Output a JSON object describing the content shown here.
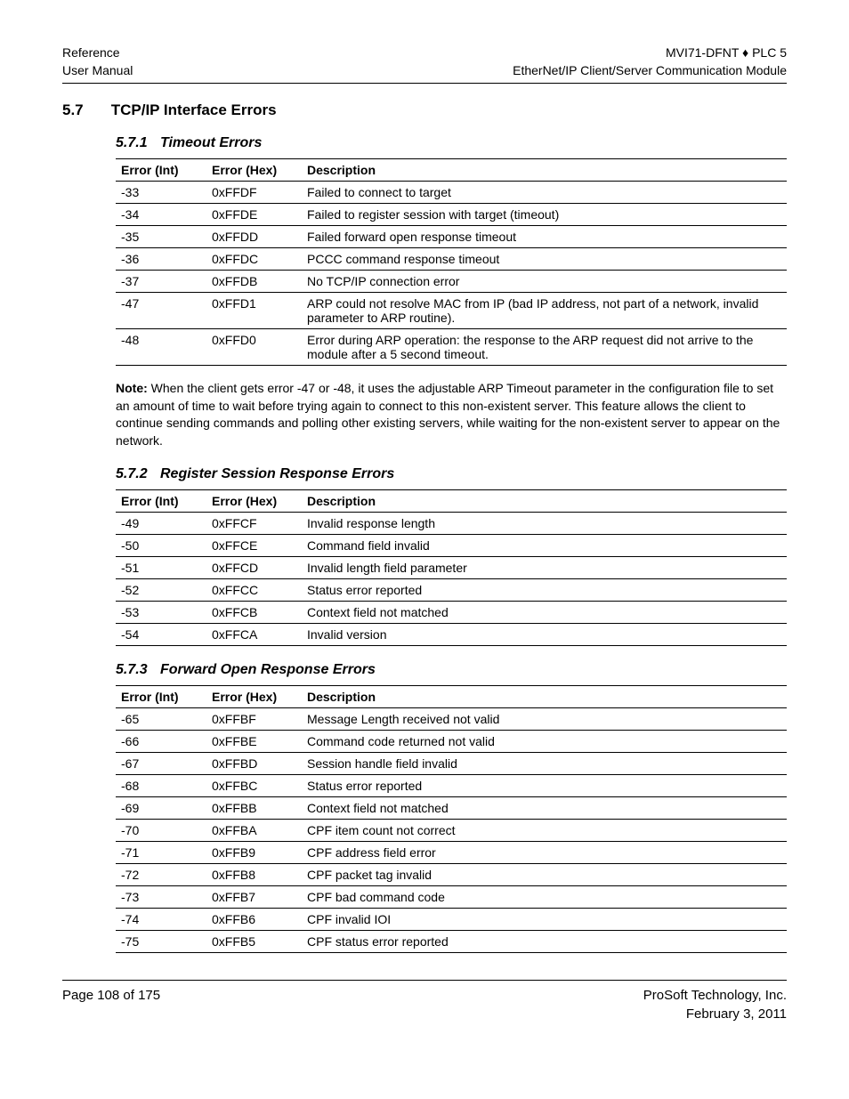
{
  "header": {
    "left_line1": "Reference",
    "left_line2": "User Manual",
    "right_line1": "MVI71-DFNT ♦ PLC 5",
    "right_line2": "EtherNet/IP Client/Server Communication Module"
  },
  "section": {
    "number": "5.7",
    "title": "TCP/IP Interface Errors"
  },
  "tables": [
    {
      "sub_number": "5.7.1",
      "sub_title": "Timeout Errors",
      "headers": {
        "c1": "Error (Int)",
        "c2": "Error (Hex)",
        "c3": "Description"
      },
      "rows": [
        {
          "int": "-33",
          "hex": "0xFFDF",
          "desc": "Failed to connect to target"
        },
        {
          "int": "-34",
          "hex": "0xFFDE",
          "desc": "Failed to register session with target (timeout)"
        },
        {
          "int": "-35",
          "hex": "0xFFDD",
          "desc": "Failed forward open response timeout"
        },
        {
          "int": "-36",
          "hex": "0xFFDC",
          "desc": "PCCC command response timeout"
        },
        {
          "int": "-37",
          "hex": "0xFFDB",
          "desc": "No TCP/IP connection error"
        },
        {
          "int": "-47",
          "hex": "0xFFD1",
          "desc": "ARP could not resolve MAC from IP (bad IP address, not part of a network, invalid parameter to ARP routine)."
        },
        {
          "int": "-48",
          "hex": "0xFFD0",
          "desc": "Error during ARP operation: the response to the ARP request did not arrive to the module after a 5 second timeout."
        }
      ]
    },
    {
      "sub_number": "5.7.2",
      "sub_title": "Register Session Response Errors",
      "headers": {
        "c1": "Error (Int)",
        "c2": "Error (Hex)",
        "c3": "Description"
      },
      "rows": [
        {
          "int": "-49",
          "hex": "0xFFCF",
          "desc": "Invalid response length"
        },
        {
          "int": "-50",
          "hex": "0xFFCE",
          "desc": "Command field invalid"
        },
        {
          "int": "-51",
          "hex": "0xFFCD",
          "desc": "Invalid length field parameter"
        },
        {
          "int": "-52",
          "hex": "0xFFCC",
          "desc": "Status error reported"
        },
        {
          "int": "-53",
          "hex": "0xFFCB",
          "desc": "Context field not matched"
        },
        {
          "int": "-54",
          "hex": "0xFFCA",
          "desc": "Invalid version"
        }
      ]
    },
    {
      "sub_number": "5.7.3",
      "sub_title": "Forward Open Response Errors",
      "headers": {
        "c1": "Error (Int)",
        "c2": "Error (Hex)",
        "c3": "Description"
      },
      "rows": [
        {
          "int": "-65",
          "hex": "0xFFBF",
          "desc": "Message Length received not valid"
        },
        {
          "int": "-66",
          "hex": "0xFFBE",
          "desc": "Command code returned not valid"
        },
        {
          "int": "-67",
          "hex": "0xFFBD",
          "desc": "Session handle field invalid"
        },
        {
          "int": "-68",
          "hex": "0xFFBC",
          "desc": "Status error reported"
        },
        {
          "int": "-69",
          "hex": "0xFFBB",
          "desc": "Context field not matched"
        },
        {
          "int": "-70",
          "hex": "0xFFBA",
          "desc": "CPF item count not correct"
        },
        {
          "int": "-71",
          "hex": "0xFFB9",
          "desc": "CPF address field error"
        },
        {
          "int": "-72",
          "hex": "0xFFB8",
          "desc": "CPF packet tag invalid"
        },
        {
          "int": "-73",
          "hex": "0xFFB7",
          "desc": "CPF bad command code"
        },
        {
          "int": "-74",
          "hex": "0xFFB6",
          "desc": "CPF invalid IOI"
        },
        {
          "int": "-75",
          "hex": "0xFFB5",
          "desc": "CPF status error reported"
        }
      ]
    }
  ],
  "note": {
    "label": "Note:",
    "text": " When the client gets error -47 or -48, it uses the adjustable ARP Timeout parameter in the configuration file to set an amount of time to wait before trying again to connect to this non-existent server. This feature allows the client to continue sending commands and polling other existing servers, while waiting for the non-existent server to appear on the network."
  },
  "footer": {
    "left": "Page 108 of 175",
    "right_line1": "ProSoft Technology, Inc.",
    "right_line2": "February 3, 2011"
  }
}
